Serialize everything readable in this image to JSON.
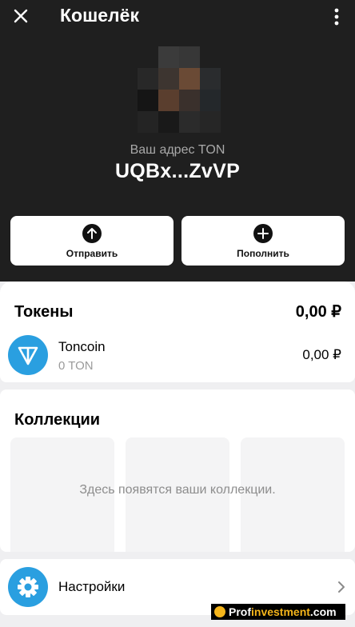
{
  "header": {
    "title": "Кошелёк",
    "close_icon": "close-icon",
    "menu_icon": "more-vertical-icon"
  },
  "wallet": {
    "address_label": "Ваш адрес TON",
    "address": "UQBx...ZvVP",
    "avatar": "blurred-avatar"
  },
  "actions": {
    "send_label": "Отправить",
    "send_icon": "arrow-up-icon",
    "topup_label": "Пополнить",
    "topup_icon": "plus-icon"
  },
  "tokens": {
    "title": "Токены",
    "total": "0,00 ₽",
    "items": [
      {
        "name": "Toncoin",
        "amount": "0 TON",
        "value": "0,00 ₽",
        "icon": "ton-icon"
      }
    ]
  },
  "collections": {
    "title": "Коллекции",
    "empty_message": "Здесь появятся ваши коллекции."
  },
  "settings": {
    "label": "Настройки",
    "icon": "gear-icon"
  },
  "watermark": {
    "part1": "Prof",
    "part2": "investment",
    "part3": ".com"
  },
  "colors": {
    "header_bg": "#1f1f1f",
    "page_bg": "#efeff1",
    "accent_blue": "#2a9fe0",
    "card_bg": "#ffffff"
  }
}
